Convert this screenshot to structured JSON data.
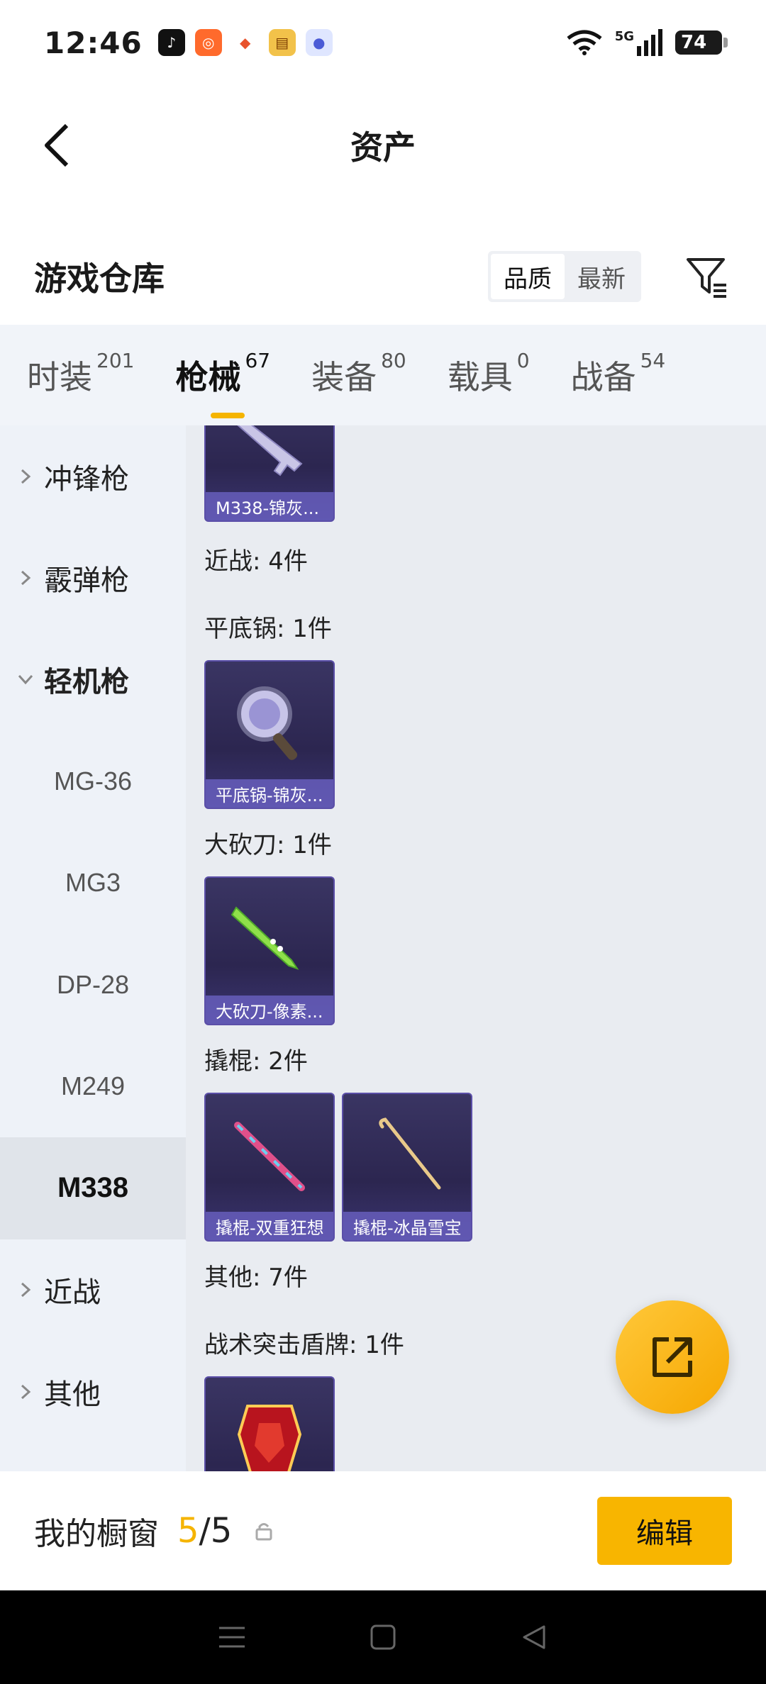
{
  "status_bar": {
    "time": "12:46",
    "battery": "74",
    "network": "5G"
  },
  "header": {
    "title": "资产"
  },
  "warehouse": {
    "title": "游戏仓库",
    "sort_options": [
      "品质",
      "最新"
    ],
    "sort_selected": "品质"
  },
  "tabs": [
    {
      "label": "时装",
      "count": "201"
    },
    {
      "label": "枪械",
      "count": "67"
    },
    {
      "label": "装备",
      "count": "80"
    },
    {
      "label": "载具",
      "count": "0"
    },
    {
      "label": "战备",
      "count": "54"
    }
  ],
  "sidebar": {
    "items": [
      {
        "label": "冲锋枪"
      },
      {
        "label": "霰弹枪"
      },
      {
        "label": "轻机枪"
      },
      {
        "label": "MG-36"
      },
      {
        "label": "MG3"
      },
      {
        "label": "DP-28"
      },
      {
        "label": "M249"
      },
      {
        "label": "M338"
      },
      {
        "label": "近战"
      },
      {
        "label": "其他"
      }
    ]
  },
  "content": {
    "top_card_label": "M338-锦灰...",
    "melee_header": "近战: 4件",
    "groups": [
      {
        "label": "平底锅: 1件",
        "items": [
          "平底锅-锦灰..."
        ]
      },
      {
        "label": "大砍刀: 1件",
        "items": [
          "大砍刀-像素..."
        ]
      },
      {
        "label": "撬棍: 2件",
        "items": [
          "撬棍-双重狂想",
          "撬棍-冰晶雪宝"
        ]
      }
    ],
    "other_header": "其他: 7件",
    "shield_group_label": "战术突击盾牌: 1件"
  },
  "showcase": {
    "title": "我的橱窗",
    "current": "5",
    "total": "/5",
    "edit_label": "编辑"
  },
  "colors": {
    "accent": "#f5b400",
    "card_bg": "#2c2650",
    "card_label_bg": "#6e64c8"
  }
}
